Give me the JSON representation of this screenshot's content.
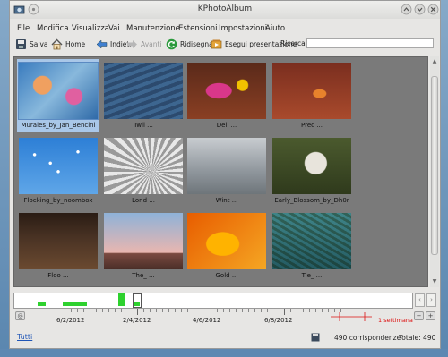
{
  "window": {
    "title": "KPhotoAlbum"
  },
  "menu": [
    "File",
    "Modifica",
    "Visualizza",
    "Vai",
    "Manutenzione",
    "Estensioni",
    "Impostazioni",
    "Aiuto"
  ],
  "toolbar": {
    "save": "Salva",
    "home": "Home",
    "back": "Indietro",
    "forward": "Avanti",
    "redraw": "Ridisegna",
    "slideshow": "Esegui presentazione",
    "search_label": "Ricerca:"
  },
  "search": {
    "value": ""
  },
  "thumbnails": [
    {
      "caption": "Murales_by_Jan_Bencini",
      "selected": true
    },
    {
      "caption": "Twil ..."
    },
    {
      "caption": "Deli ..."
    },
    {
      "caption": "Prec ..."
    },
    {
      "caption": "Flocking_by_noombox"
    },
    {
      "caption": "Lond ..."
    },
    {
      "caption": "Wint ..."
    },
    {
      "caption": "Early_Blossom_by_Dh0r"
    },
    {
      "caption": "Floo ..."
    },
    {
      "caption": "The_ ..."
    },
    {
      "caption": "Gold ..."
    },
    {
      "caption": "Tie_ ..."
    }
  ],
  "timeline": {
    "dates": [
      "6/2/2012",
      "2/4/2012",
      "4/6/2012",
      "6/8/2012"
    ],
    "unit": "1 settimana"
  },
  "status": {
    "all_link": "Tutti",
    "matches": "490 corrispondenze",
    "total": "Totale: 490"
  },
  "colors": {
    "accent": "#2ed12e",
    "selection": "#a9c7e8",
    "link": "#1f55b6"
  }
}
